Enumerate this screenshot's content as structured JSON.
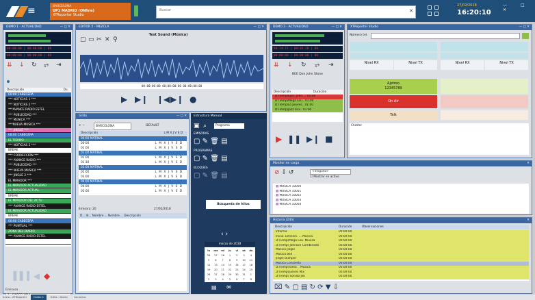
{
  "header": {
    "station_city": "BARCELONA",
    "station_name": "UP1 MADRID (ONline)",
    "app_name": "XTReporter Studio",
    "search_placeholder": "Buscar",
    "date": "27/02/2018",
    "clock": "16:20:10",
    "win_controls": "— □ ✕"
  },
  "player1": {
    "title": "DEMO 1 - ACTUALIDAD",
    "tc1": "00:00:00",
    "tc2": "00:00:00",
    "tc3": "00",
    "tc4": "00:00:00",
    "tc5": "00:00:00",
    "tc6": "00"
  },
  "editor": {
    "title": "EDITOR 2 - MEZCLA",
    "track_title": "Test Sound (Música)",
    "counter": "00:00:00:00 00:00:00:00 00:00:00:00"
  },
  "player2": {
    "title": "DEMO 3 - ACTUALIDAD",
    "tc1": "00:24:15",
    "tc2": "00:03:28",
    "tc3": "00",
    "tc4": "00:00:00",
    "tc5": "00:00:00",
    "tc6": "00",
    "now": "BEE Don John Stone"
  },
  "studio": {
    "title": "XTReporter Studio",
    "phone_label": "Número tel.",
    "nivel_rx": "Nivel RX",
    "nivel_tx": "Nivel TX",
    "caller_name": "Ajetreo",
    "caller_number": "12345789",
    "on_air": "On Air",
    "talk": "Talk",
    "chatter": "Chatter"
  },
  "playlist": {
    "header": "Descripción",
    "dur_header": "Du.",
    "items": [
      {
        "label": "00:00 CABECERA",
        "color": "#3b73b9"
      },
      {
        "label": "*** NOTICIAS 1 ***",
        "color": "#1a1a1a"
      },
      {
        "label": "*** NOTICIAS 2 ***",
        "color": "#1a1a1a"
      },
      {
        "label": "***AVANCE RADIO ESTEL",
        "color": "#1a1a1a"
      },
      {
        "label": "*** PUBLICIDAD ***",
        "color": "#1a1a1a"
      },
      {
        "label": "*** MUSICA ***",
        "color": "#1a1a1a"
      },
      {
        "label": "***NUEVA MUSICA ***",
        "color": "#1a1a1a"
      },
      {
        "label": "*** JINGLE ***",
        "color": "#e06fb0"
      },
      {
        "label": "08:00 CABECERA",
        "color": "#3b73b9"
      },
      {
        "label": "EL TIEMPO",
        "color": "#3aa65a"
      },
      {
        "label": "*** NOTICIAS 2 ***",
        "color": "#1a1a1a"
      },
      {
        "label": "BREAK",
        "color": "#ffffff",
        "dark": true
      },
      {
        "label": "*** CORRECCIÓN ***",
        "color": "#1a1a1a"
      },
      {
        "label": "*** AVANCE RADIO ***",
        "color": "#1a1a1a"
      },
      {
        "label": "*** PUBLICIDAD ***",
        "color": "#1a1a1a"
      },
      {
        "label": "*** NUEVA MUSICA ***",
        "color": "#1a1a1a"
      },
      {
        "label": "*** JINGLE 2 ***",
        "color": "#1a1a1a"
      },
      {
        "label": "EL MIRADOR ***",
        "color": "#1a1a1a"
      },
      {
        "label": "EL MIRADOR ACTUALIDAD",
        "color": "#3aa65a"
      },
      {
        "label": "EL MIRADOR ACTUAL",
        "color": "#3aa65a"
      },
      {
        "label": "BREAK",
        "color": "#ffffff",
        "dark": true
      },
      {
        "label": "EL MIRADOR DEL ACTU",
        "color": "#3aa65a"
      },
      {
        "label": "*** AVANCE RADIO ESTEL",
        "color": "#1a1a1a"
      },
      {
        "label": "EL MIRADOR ACTUALIDAD",
        "color": "#3aa65a"
      },
      {
        "label": "BREAK",
        "color": "#ffffff",
        "dark": true
      },
      {
        "label": "00:00 CABECERA",
        "color": "#3b73b9"
      },
      {
        "label": "*** PUNTUAL ***",
        "color": "#1a1a1a"
      },
      {
        "label": "ZONA DEL DIARIO",
        "color": "#3aa65a"
      },
      {
        "label": "*** AVANCE RADIO ESTEL",
        "color": "#1a1a1a"
      },
      {
        "label": "",
        "color": "#ffffff",
        "dark": true
      }
    ],
    "footer_label": "Emisora",
    "footer_value": "1 - BARCELONA"
  },
  "grid": {
    "title": "Grilla",
    "station": "BARCELONA",
    "mode": "DEFAULT",
    "col_desc": "Descripción",
    "col_flags": "L M X J V S D",
    "rows": [
      {
        "label": "00:00 MATINAL",
        "blue": true
      },
      {
        "label": "00:00",
        "blue": false
      },
      {
        "label": "01:00",
        "blue": false
      },
      {
        "label": "01:00 MATINAL",
        "blue": true
      },
      {
        "label": "01:00",
        "blue": false
      },
      {
        "label": "01:30",
        "blue": false
      },
      {
        "label": "02:00 MATINAL",
        "blue": true
      },
      {
        "label": "02:00",
        "blue": false
      },
      {
        "label": "03:00",
        "blue": false
      },
      {
        "label": "04:00 MATINAL",
        "blue": true
      },
      {
        "label": "04:00",
        "blue": false
      },
      {
        "label": "05:00",
        "blue": false
      }
    ],
    "bottom_left": "Emisora: 20",
    "bottom_date": "27/02/2018",
    "bottom_cols": "D... Id... Nombre ... Nombre ... Descripción"
  },
  "tools": {
    "title": "Estructura",
    "title2": "Manual",
    "dropdown": "Programa",
    "section1": "EMISORAS",
    "section2": "PROGRAMAS",
    "section3": "BLOQUES",
    "search_btn": "Búsqueda de hilos",
    "month": "marzo de 2018",
    "cal_days": [
      "lu",
      "ma",
      "mi",
      "ju",
      "vi",
      "sá",
      "do"
    ],
    "cal_rows": [
      [
        "26",
        "27",
        "28",
        "1",
        "2",
        "3",
        "4"
      ],
      [
        "5",
        "6",
        "7",
        "8",
        "9",
        "10",
        "11"
      ],
      [
        "12",
        "13",
        "14",
        "15",
        "16",
        "17",
        "18"
      ],
      [
        "19",
        "20",
        "21",
        "22",
        "23",
        "24",
        "25"
      ],
      [
        "26",
        "27",
        "28",
        "29",
        "30",
        "31",
        "1"
      ],
      [
        "2",
        "3",
        "4",
        "5",
        "6",
        "7",
        "8"
      ]
    ]
  },
  "player2_list": {
    "header": "Descripción",
    "dur": "Duración",
    "items": [
      {
        "label": "D:\\Temp\\Ejec. John. .. 01:00",
        "color": "#d63a3a"
      },
      {
        "label": "D:\\Temp\\Mega Lou.. 01:00",
        "color": "#8fbf4a"
      },
      {
        "label": "D:\\Temp\\Lo Jueves.. 01:00",
        "color": "#8fbf4a"
      },
      {
        "label": "D:\\Temp\\Jazz mix.. 01:00",
        "color": "#8fbf4a"
      }
    ]
  },
  "loader": {
    "title": "Monitor de carga",
    "dropdown": "<ninguno>",
    "checkbox": "Mostrar en activo",
    "items": [
      "MUSICA 10000",
      "MUSICA 10001",
      "MUSICA 10002",
      "MUSICA 10003",
      "MUSICA 10004"
    ]
  },
  "events": {
    "title": "Historia (24h)",
    "col1": "Descripción",
    "col2": "Duración",
    "col3": "Observaciones",
    "items": [
      {
        "label": "Informe",
        "dur": "00:00:00",
        "color": "#dfe56a"
      },
      {
        "label": "Inicio. Emisión. ... Música",
        "dur": "00:00:00",
        "color": "#dfe56a"
      },
      {
        "label": "D:\\Temp\\Mega Lou. Música",
        "dur": "00:00:00",
        "color": "#dfe56a"
      },
      {
        "label": "D:\\Temp\\ Johnson Combinado",
        "dur": "00:00:00",
        "color": "#dfe56a"
      },
      {
        "label": "Música Jingle",
        "dur": "00:00:00",
        "color": "#dfe56a"
      },
      {
        "label": "Música Bsd",
        "dur": "00:00:00",
        "color": "#dfe56a"
      },
      {
        "label": "Jingle Bumper",
        "dur": "00:00:00",
        "color": "#dfe56a"
      },
      {
        "label": "Música Concierto",
        "dur": "00:00:00",
        "color": "#b0bdd6"
      },
      {
        "label": "D:\\Temp\\Tarea. . Música",
        "dur": "00:00:00",
        "color": "#dfe56a"
      },
      {
        "label": "D:\\Temp\\Jueves Mix",
        "dur": "00:00:00",
        "color": "#dfe56a"
      },
      {
        "label": "D:\\Temp\\ Sonido Jok",
        "dur": "00:00:00",
        "color": "#dfe56a"
      }
    ]
  },
  "taskbar": [
    "Inicio - XTReporter",
    "Orden 1",
    "Grilla - Diario",
    "Anuncios"
  ]
}
